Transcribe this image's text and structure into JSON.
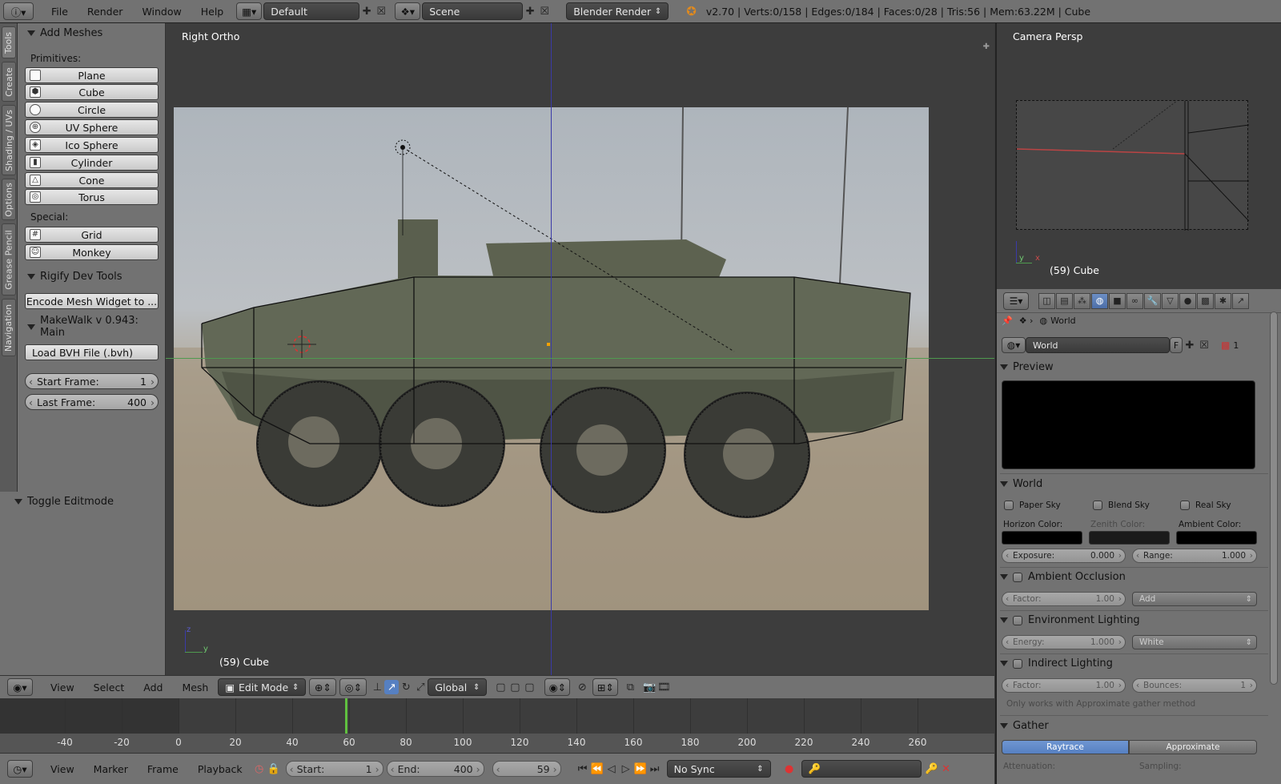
{
  "topbar": {
    "menus": [
      "File",
      "Render",
      "Window",
      "Help"
    ],
    "layout": "Default",
    "scene": "Scene",
    "engine": "Blender Render",
    "stats": "v2.70 | Verts:0/158 | Edges:0/184 | Faces:0/28 | Tris:56 | Mem:63.22M | Cube"
  },
  "tabs": [
    "Tools",
    "Create",
    "Shading / UVs",
    "Options",
    "Grease Pencil",
    "Navigation"
  ],
  "toolshelf": {
    "add_meshes": "Add Meshes",
    "primitives_label": "Primitives:",
    "primitives": [
      "Plane",
      "Cube",
      "Circle",
      "UV Sphere",
      "Ico Sphere",
      "Cylinder",
      "Cone",
      "Torus"
    ],
    "special_label": "Special:",
    "special": [
      "Grid",
      "Monkey"
    ],
    "rigify": "Rigify Dev Tools",
    "encode_btn": "Encode Mesh Widget to ...",
    "makewalk": "MakeWalk v 0.943: Main",
    "load_bvh": "Load BVH File (.bvh)",
    "start_frame_label": "Start Frame:",
    "start_frame": "1",
    "last_frame_label": "Last Frame:",
    "last_frame": "400",
    "toggle_editmode": "Toggle Editmode"
  },
  "viewport": {
    "view_name": "Right Ortho",
    "object": "(59) Cube",
    "axis_z": "z",
    "axis_y": "y"
  },
  "camview": {
    "view_name": "Camera Persp",
    "object": "(59) Cube",
    "axis_x": "x",
    "axis_y": "y"
  },
  "props": {
    "context": "World",
    "world_name": "World",
    "world_flag": "F",
    "users": "1",
    "preview": "Preview",
    "world_section": "World",
    "paper_sky": "Paper Sky",
    "blend_sky": "Blend Sky",
    "real_sky": "Real Sky",
    "horizon_color": "Horizon Color:",
    "zenith_color": "Zenith Color:",
    "ambient_color": "Ambient Color:",
    "exposure_label": "Exposure:",
    "exposure": "0.000",
    "range_label": "Range:",
    "range": "1.000",
    "ao": "Ambient Occlusion",
    "factor_label": "Factor:",
    "ao_factor": "1.00",
    "ao_blend": "Add",
    "env": "Environment Lighting",
    "energy_label": "Energy:",
    "energy": "1.000",
    "env_color": "White",
    "indirect": "Indirect Lighting",
    "ind_factor": "1.00",
    "bounces_label": "Bounces:",
    "bounces": "1",
    "note": "Only works with Approximate gather method",
    "gather": "Gather",
    "raytrace": "Raytrace",
    "approximate": "Approximate",
    "attenuation": "Attenuation:",
    "sampling": "Sampling:"
  },
  "vp_header": {
    "menus": [
      "View",
      "Select",
      "Add",
      "Mesh"
    ],
    "mode": "Edit Mode",
    "orientation": "Global"
  },
  "timeline": {
    "ticks": [
      "-40",
      "-20",
      "0",
      "20",
      "40",
      "60",
      "80",
      "100",
      "120",
      "140",
      "160",
      "180",
      "200",
      "220",
      "240",
      "260"
    ],
    "current_frame_value": 59,
    "menus": [
      "View",
      "Marker",
      "Frame",
      "Playback"
    ],
    "start_label": "Start:",
    "start": "1",
    "end_label": "End:",
    "end": "400",
    "current": "59",
    "sync": "No Sync"
  },
  "colors": {
    "accent_blue": "#5680c2",
    "x_axis": "#c94a4a",
    "y_axis": "#4f9a4f",
    "z_axis": "#3a3aa8"
  }
}
